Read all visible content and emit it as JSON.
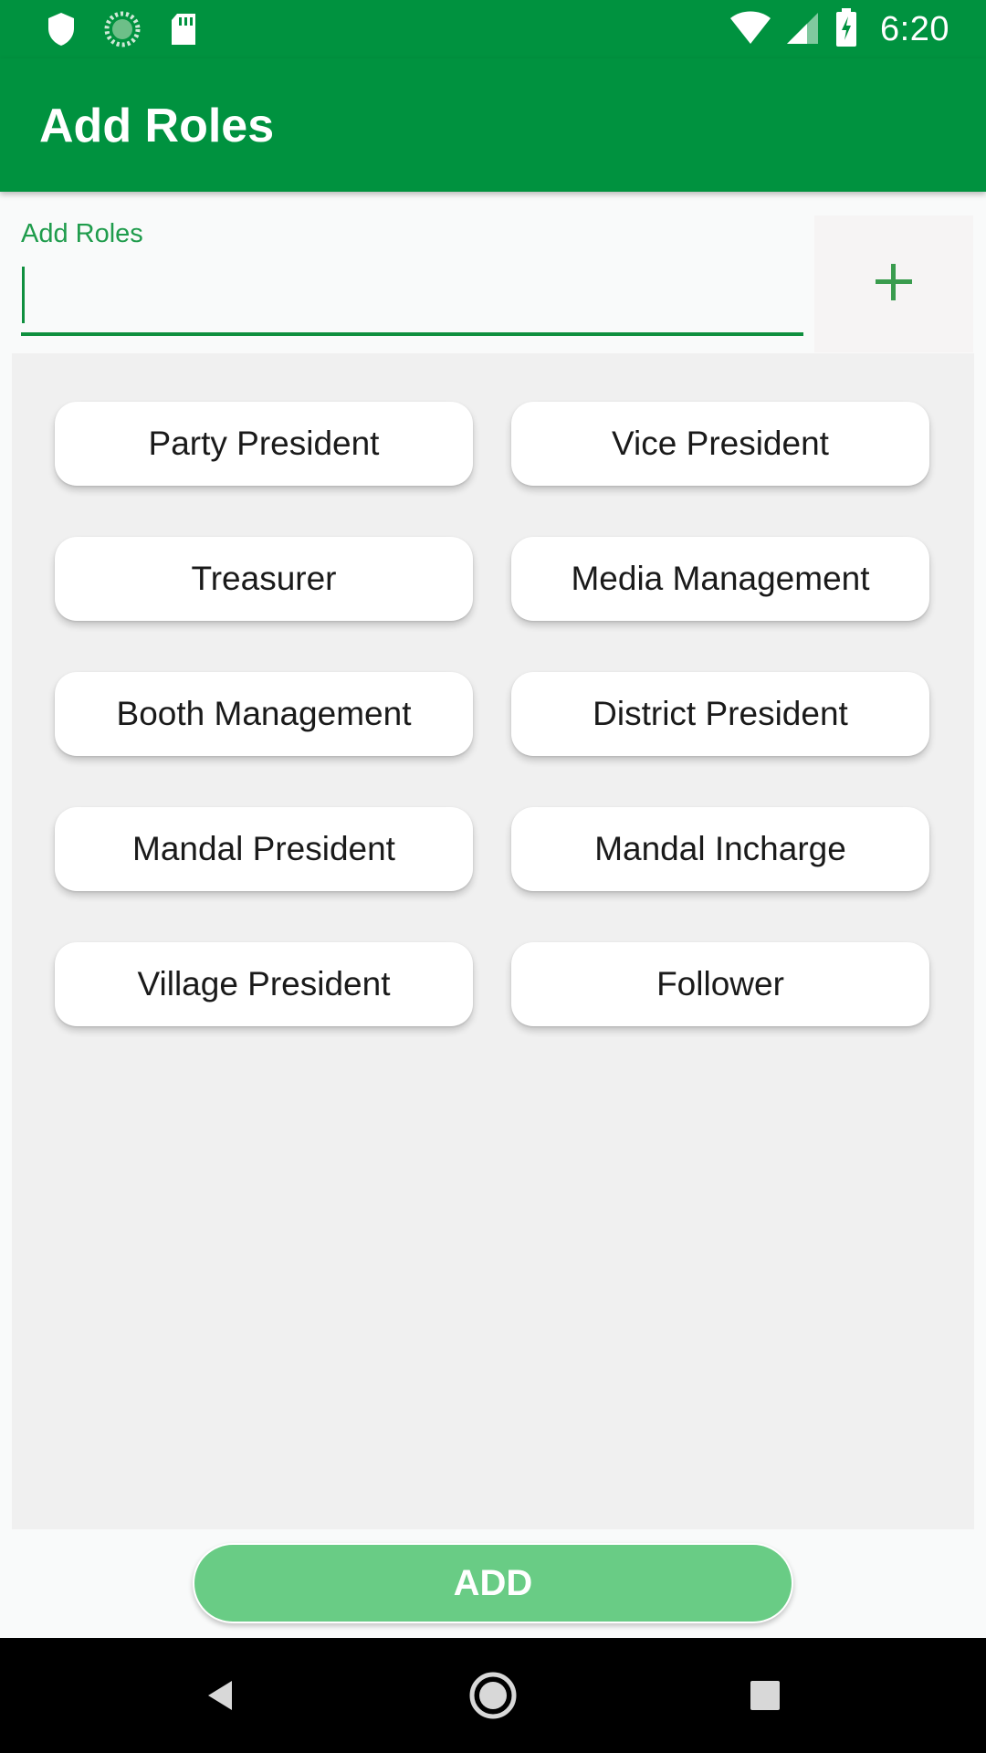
{
  "status_bar": {
    "time": "6:20",
    "left_icons": [
      "shield-icon",
      "loading-icon",
      "sd-card-icon"
    ],
    "right_icons": [
      "wifi-icon",
      "signal-icon",
      "battery-charging-icon"
    ]
  },
  "app_bar": {
    "title": "Add Roles"
  },
  "role_input": {
    "label": "Add Roles",
    "value": "",
    "placeholder": ""
  },
  "plus_button": {
    "icon": "plus-icon"
  },
  "roles": [
    "Party President",
    "Vice President",
    "Treasurer",
    "Media Management",
    "Booth Management",
    "District President",
    "Mandal President",
    "Mandal Incharge",
    "Village President",
    "Follower"
  ],
  "add_button": {
    "label": "ADD"
  },
  "nav_bar": {
    "icons": [
      "back-icon",
      "home-icon",
      "recents-icon"
    ]
  },
  "colors": {
    "primary": "#00923f",
    "accent": "#0f8f3e",
    "add_button": "#69cc85",
    "panel": "#f0f0f0"
  }
}
